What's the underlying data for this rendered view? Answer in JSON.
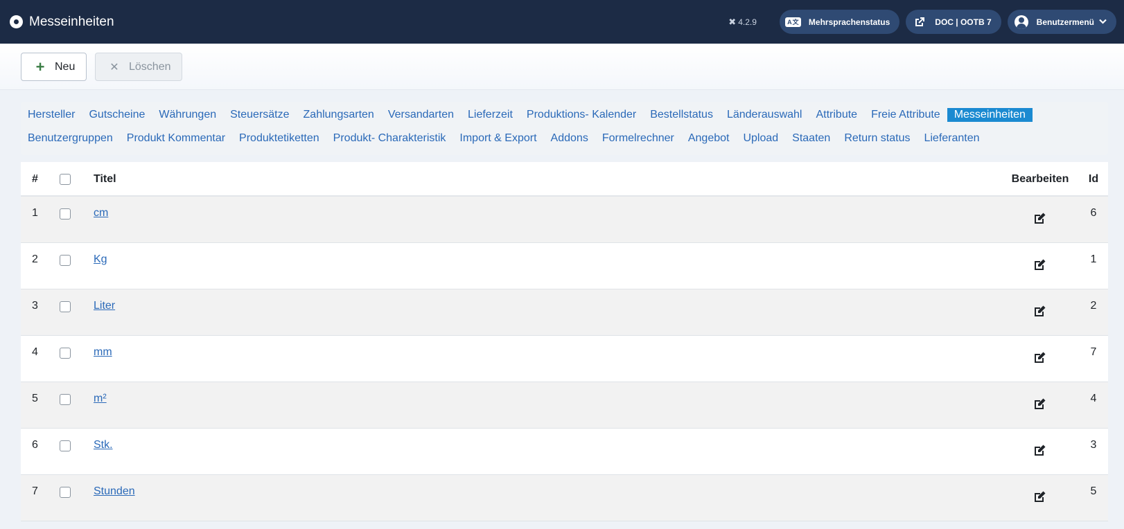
{
  "header": {
    "title": "Messeinheiten",
    "version": "4.2.9",
    "version_icon": "joomla-icon",
    "pills": [
      {
        "label": "Mehrsprachenstatus",
        "icon": "language-icon",
        "icon_text": "A文"
      },
      {
        "label": "DOC | OOTB 7",
        "icon": "external-link-icon"
      },
      {
        "label": "Benutzermenü",
        "icon": "user-icon"
      }
    ]
  },
  "toolbar": {
    "new_label": "Neu",
    "new_icon": "+",
    "delete_label": "Löschen",
    "delete_icon": "✕"
  },
  "submenu": {
    "row1": [
      "Hersteller",
      "Gutscheine",
      "Währungen",
      "Steuersätze",
      "Zahlungsarten",
      "Versandarten",
      "Lieferzeit",
      "Produktions- Kalender",
      "Bestellstatus",
      "Länderauswahl",
      "Attribute",
      "Freie Attribute",
      "Messeinheiten"
    ],
    "row2": [
      "Benutzergruppen",
      "Produkt Kommentar",
      "Produktetiketten",
      "Produkt- Charakteristik",
      "Import & Export",
      "Addons",
      "Formelrechner",
      "Angebot",
      "Upload",
      "Staaten",
      "Return status",
      "Lieferanten"
    ],
    "active": "Messeinheiten"
  },
  "table": {
    "headers": {
      "num": "#",
      "title": "Titel",
      "edit": "Bearbeiten",
      "id": "Id"
    },
    "rows": [
      {
        "num": "1",
        "title": "cm",
        "id": "6"
      },
      {
        "num": "2",
        "title": "Kg",
        "id": "1"
      },
      {
        "num": "3",
        "title": "Liter",
        "id": "2"
      },
      {
        "num": "4",
        "title": "mm",
        "id": "7"
      },
      {
        "num": "5",
        "title": "m²",
        "id": "4"
      },
      {
        "num": "6",
        "title": "Stk.",
        "id": "3"
      },
      {
        "num": "7",
        "title": "Stunden",
        "id": "5"
      }
    ]
  },
  "colors": {
    "header_bg": "#1c2b45",
    "pill_bg": "#2f4a73",
    "link": "#2a69b8",
    "active_tab_bg": "#1b8ad1"
  }
}
